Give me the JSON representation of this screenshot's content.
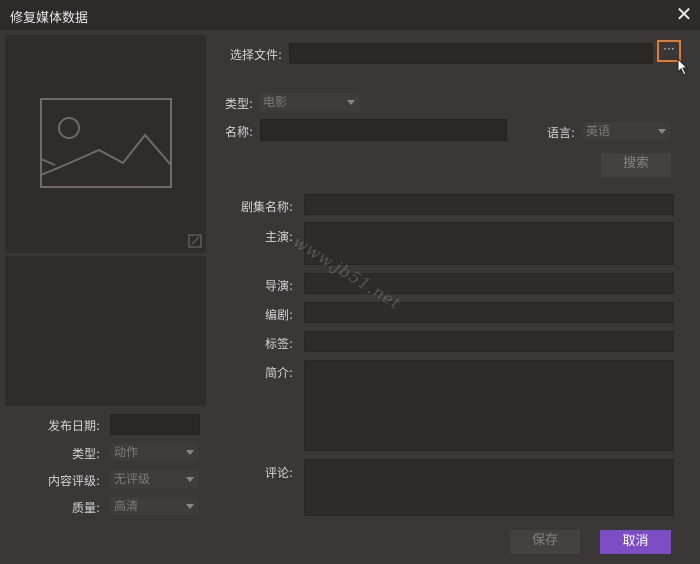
{
  "window": {
    "title": "修复媒体数据",
    "close_glyph": "✕"
  },
  "file": {
    "label": "选择文件:",
    "value": "",
    "browse_label": "···"
  },
  "search": {
    "type_label": "类型:",
    "type_value": "电影",
    "name_label": "名称:",
    "name_value": "",
    "language_label": "语言:",
    "language_value": "英语",
    "search_button": "搜索"
  },
  "details": {
    "series_label": "剧集名称:",
    "cast_label": "主演:",
    "director_label": "导演:",
    "writer_label": "编剧:",
    "tags_label": "标签:",
    "summary_label": "简介:",
    "comment_label": "评论:"
  },
  "left": {
    "release_label": "发布日期:",
    "release_value": "",
    "genre_label": "类型:",
    "genre_value": "动作",
    "rating_label": "内容评级:",
    "rating_value": "无评级",
    "quality_label": "质量:",
    "quality_value": "高清"
  },
  "buttons": {
    "save": "保存",
    "cancel": "取消"
  },
  "watermark": "www.jb51.net",
  "colors": {
    "accent": "#7c4dc4",
    "browse_border": "#e07a2c",
    "background": "#3a3737"
  }
}
